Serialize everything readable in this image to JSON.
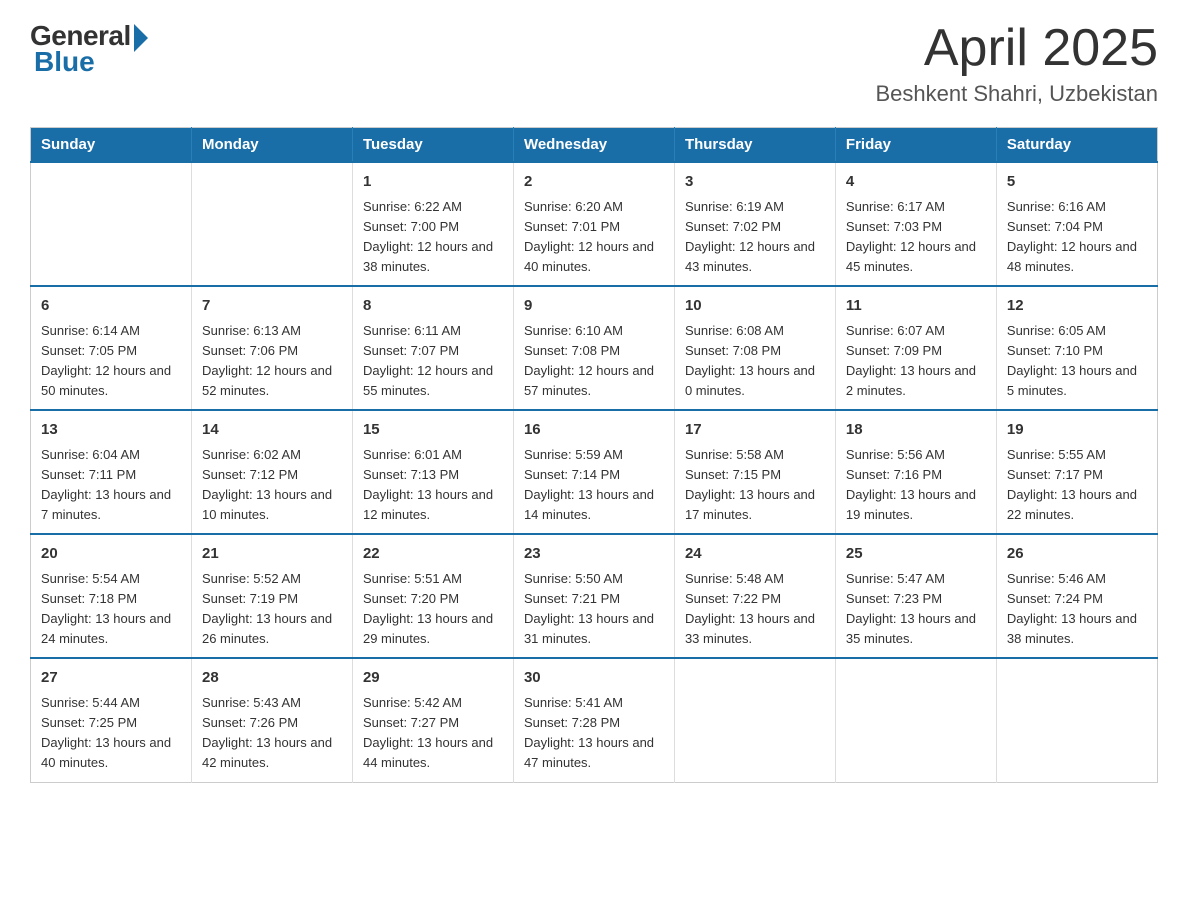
{
  "header": {
    "logo_general": "General",
    "logo_blue": "Blue",
    "main_title": "April 2025",
    "subtitle": "Beshkent Shahri, Uzbekistan"
  },
  "calendar": {
    "days_of_week": [
      "Sunday",
      "Monday",
      "Tuesday",
      "Wednesday",
      "Thursday",
      "Friday",
      "Saturday"
    ],
    "weeks": [
      [
        {
          "day": "",
          "info": ""
        },
        {
          "day": "",
          "info": ""
        },
        {
          "day": "1",
          "info": "Sunrise: 6:22 AM\nSunset: 7:00 PM\nDaylight: 12 hours\nand 38 minutes."
        },
        {
          "day": "2",
          "info": "Sunrise: 6:20 AM\nSunset: 7:01 PM\nDaylight: 12 hours\nand 40 minutes."
        },
        {
          "day": "3",
          "info": "Sunrise: 6:19 AM\nSunset: 7:02 PM\nDaylight: 12 hours\nand 43 minutes."
        },
        {
          "day": "4",
          "info": "Sunrise: 6:17 AM\nSunset: 7:03 PM\nDaylight: 12 hours\nand 45 minutes."
        },
        {
          "day": "5",
          "info": "Sunrise: 6:16 AM\nSunset: 7:04 PM\nDaylight: 12 hours\nand 48 minutes."
        }
      ],
      [
        {
          "day": "6",
          "info": "Sunrise: 6:14 AM\nSunset: 7:05 PM\nDaylight: 12 hours\nand 50 minutes."
        },
        {
          "day": "7",
          "info": "Sunrise: 6:13 AM\nSunset: 7:06 PM\nDaylight: 12 hours\nand 52 minutes."
        },
        {
          "day": "8",
          "info": "Sunrise: 6:11 AM\nSunset: 7:07 PM\nDaylight: 12 hours\nand 55 minutes."
        },
        {
          "day": "9",
          "info": "Sunrise: 6:10 AM\nSunset: 7:08 PM\nDaylight: 12 hours\nand 57 minutes."
        },
        {
          "day": "10",
          "info": "Sunrise: 6:08 AM\nSunset: 7:08 PM\nDaylight: 13 hours\nand 0 minutes."
        },
        {
          "day": "11",
          "info": "Sunrise: 6:07 AM\nSunset: 7:09 PM\nDaylight: 13 hours\nand 2 minutes."
        },
        {
          "day": "12",
          "info": "Sunrise: 6:05 AM\nSunset: 7:10 PM\nDaylight: 13 hours\nand 5 minutes."
        }
      ],
      [
        {
          "day": "13",
          "info": "Sunrise: 6:04 AM\nSunset: 7:11 PM\nDaylight: 13 hours\nand 7 minutes."
        },
        {
          "day": "14",
          "info": "Sunrise: 6:02 AM\nSunset: 7:12 PM\nDaylight: 13 hours\nand 10 minutes."
        },
        {
          "day": "15",
          "info": "Sunrise: 6:01 AM\nSunset: 7:13 PM\nDaylight: 13 hours\nand 12 minutes."
        },
        {
          "day": "16",
          "info": "Sunrise: 5:59 AM\nSunset: 7:14 PM\nDaylight: 13 hours\nand 14 minutes."
        },
        {
          "day": "17",
          "info": "Sunrise: 5:58 AM\nSunset: 7:15 PM\nDaylight: 13 hours\nand 17 minutes."
        },
        {
          "day": "18",
          "info": "Sunrise: 5:56 AM\nSunset: 7:16 PM\nDaylight: 13 hours\nand 19 minutes."
        },
        {
          "day": "19",
          "info": "Sunrise: 5:55 AM\nSunset: 7:17 PM\nDaylight: 13 hours\nand 22 minutes."
        }
      ],
      [
        {
          "day": "20",
          "info": "Sunrise: 5:54 AM\nSunset: 7:18 PM\nDaylight: 13 hours\nand 24 minutes."
        },
        {
          "day": "21",
          "info": "Sunrise: 5:52 AM\nSunset: 7:19 PM\nDaylight: 13 hours\nand 26 minutes."
        },
        {
          "day": "22",
          "info": "Sunrise: 5:51 AM\nSunset: 7:20 PM\nDaylight: 13 hours\nand 29 minutes."
        },
        {
          "day": "23",
          "info": "Sunrise: 5:50 AM\nSunset: 7:21 PM\nDaylight: 13 hours\nand 31 minutes."
        },
        {
          "day": "24",
          "info": "Sunrise: 5:48 AM\nSunset: 7:22 PM\nDaylight: 13 hours\nand 33 minutes."
        },
        {
          "day": "25",
          "info": "Sunrise: 5:47 AM\nSunset: 7:23 PM\nDaylight: 13 hours\nand 35 minutes."
        },
        {
          "day": "26",
          "info": "Sunrise: 5:46 AM\nSunset: 7:24 PM\nDaylight: 13 hours\nand 38 minutes."
        }
      ],
      [
        {
          "day": "27",
          "info": "Sunrise: 5:44 AM\nSunset: 7:25 PM\nDaylight: 13 hours\nand 40 minutes."
        },
        {
          "day": "28",
          "info": "Sunrise: 5:43 AM\nSunset: 7:26 PM\nDaylight: 13 hours\nand 42 minutes."
        },
        {
          "day": "29",
          "info": "Sunrise: 5:42 AM\nSunset: 7:27 PM\nDaylight: 13 hours\nand 44 minutes."
        },
        {
          "day": "30",
          "info": "Sunrise: 5:41 AM\nSunset: 7:28 PM\nDaylight: 13 hours\nand 47 minutes."
        },
        {
          "day": "",
          "info": ""
        },
        {
          "day": "",
          "info": ""
        },
        {
          "day": "",
          "info": ""
        }
      ]
    ]
  }
}
